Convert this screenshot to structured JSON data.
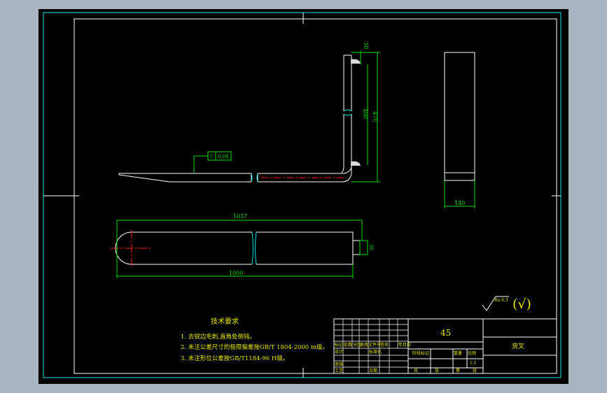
{
  "drawing": {
    "material": "45",
    "part_name": "货叉",
    "colors": {
      "background": "#000000",
      "outline": "#ffffff",
      "border": "#00e5e5",
      "dimension": "#00e000",
      "center_line": "#ff2020",
      "text": "#e8e800",
      "hatch": "#d8d8d8"
    }
  },
  "dimensions": {
    "length_overall": "1037",
    "length": "1000",
    "height_overall": "470",
    "height_inner": "400",
    "top_offset": "30",
    "width": "140",
    "pin_diameter": "30"
  },
  "annotations": {
    "flatness_symbol": "C",
    "flatness_value": "0.08",
    "roughness": "Ra 6.3",
    "roughness_general": "(√)"
  },
  "tech_requirements": {
    "title": "技术要求",
    "items": [
      "1. 去锐边毛刺,直角处倒钝。",
      "2. 未注公差尺寸的极限偏差按GB/T 1804-2000 m级。",
      "3. 未注形位公差按GB/T1184-96 H级。"
    ]
  },
  "title_block": {
    "rev_row": [
      "标记",
      "处数",
      "分区",
      "更改文件号",
      "签名",
      "年月日"
    ],
    "design": "设计",
    "standardize": "标准化",
    "review": "审核",
    "process": "工艺",
    "approve": "日期",
    "stage_mark": "阶段标记",
    "weight": "重量",
    "scale": "比例",
    "scale_value": "1:1",
    "total": "共",
    "sheets": "张",
    "page": "第",
    "page_sheets": "张"
  }
}
